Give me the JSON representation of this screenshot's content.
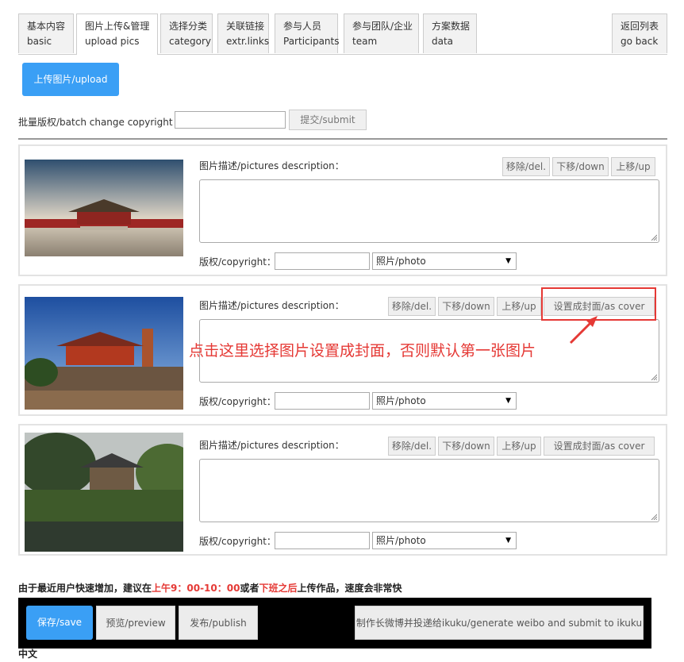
{
  "tabs": [
    {
      "line1": "基本内容",
      "line2": "basic"
    },
    {
      "line1": "图片上传&管理",
      "line2": "upload pics"
    },
    {
      "line1": "选择分类",
      "line2": "category"
    },
    {
      "line1": "关联链接",
      "line2": "extr.links"
    },
    {
      "line1": "参与人员",
      "line2": "Participants"
    },
    {
      "line1": "参与团队/企业",
      "line2": "team"
    },
    {
      "line1": "方案数据",
      "line2": "data"
    }
  ],
  "go_back": {
    "line1": "返回列表",
    "line2": "go back"
  },
  "upload_button": "上传图片/upload",
  "batch": {
    "label": "批量版权/batch change copyright ：",
    "submit": "提交/submit"
  },
  "cards": [
    {
      "desc_label": "图片描述/pictures description：",
      "del": "移除/del.",
      "down": "下移/down",
      "up": "上移/up",
      "copyright_label": "版权/copyright：",
      "type_value": "照片/photo"
    },
    {
      "desc_label": "图片描述/pictures description：",
      "del": "移除/del.",
      "down": "下移/down",
      "up": "上移/up",
      "cover": "设置成封面/as cover",
      "copyright_label": "版权/copyright：",
      "type_value": "照片/photo"
    },
    {
      "desc_label": "图片描述/pictures description：",
      "del": "移除/del.",
      "down": "下移/down",
      "up": "上移/up",
      "cover": "设置成封面/as cover",
      "copyright_label": "版权/copyright：",
      "type_value": "照片/photo"
    }
  ],
  "annotation": "点击这里选择图片设置成封面，否则默认第一张图片",
  "notice": {
    "part1": "由于最近用户快速增加，建议在",
    "part2": "上午9：00-10：00",
    "part3": "或者",
    "part4": "下班之后",
    "part5": "上传作品，速度会非常快"
  },
  "bottom": {
    "save": "保存/save",
    "preview": "预览/preview",
    "publish": "发布/publish",
    "weibo": "制作长微博并投递给ikuku/generate weibo and submit to ikuku"
  },
  "language": "中文",
  "colors": {
    "primary": "#3a9ff5",
    "annotation": "#e53935",
    "bar": "#000000"
  }
}
